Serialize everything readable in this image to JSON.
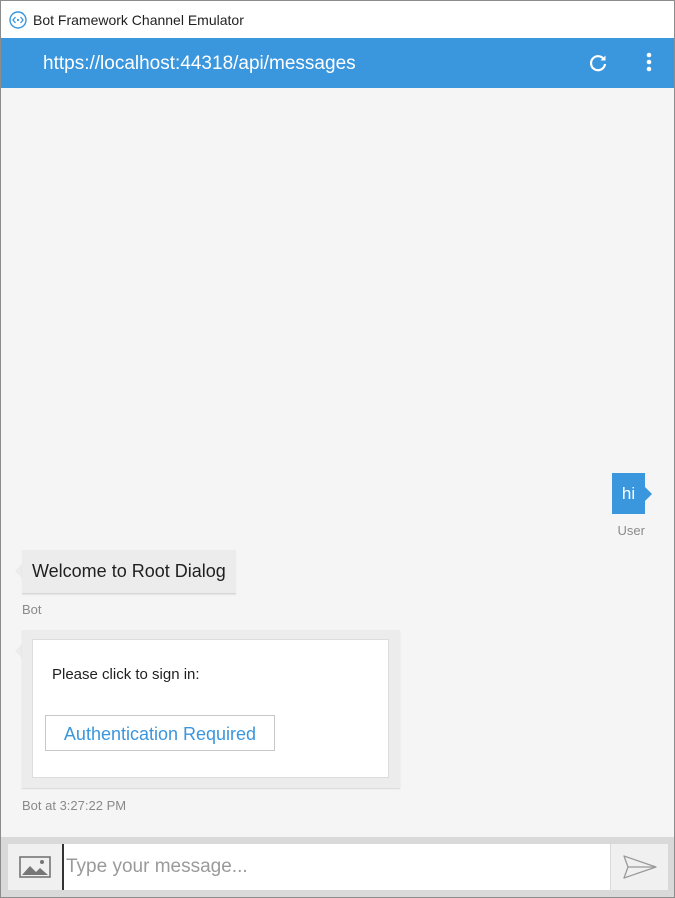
{
  "window": {
    "title": "Bot Framework Channel Emulator",
    "app_icon": "bot-emulator-icon"
  },
  "addressbar": {
    "url": "https://localhost:44318/api/messages",
    "refresh_icon": "refresh-icon",
    "menu_icon": "more-vertical-icon"
  },
  "messages": [
    {
      "from": "user",
      "text": "hi",
      "label": "User"
    },
    {
      "from": "bot",
      "text": "Welcome to Root Dialog",
      "label": "Bot"
    }
  ],
  "card": {
    "text": "Please click to sign in:",
    "button_label": "Authentication Required",
    "timestamp": "Bot at 3:27:22 PM"
  },
  "inputbar": {
    "placeholder": "Type your message...",
    "value": "",
    "upload_icon": "image-upload-icon",
    "send_icon": "send-icon"
  },
  "colors": {
    "accent": "#3a96dd",
    "chat_background": "#f5f5f5",
    "bot_bubble": "#ececec",
    "meta_text": "#8a8a8a"
  }
}
